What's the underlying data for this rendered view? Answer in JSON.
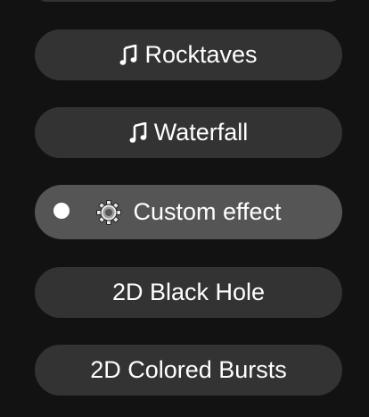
{
  "effects": {
    "items": [
      {
        "label": "Rocktaves",
        "icon": "music-note-icon"
      },
      {
        "label": "Waterfall",
        "icon": "music-note-icon"
      },
      {
        "label": "Custom effect",
        "icon": "gear-icon",
        "selected": true
      },
      {
        "label": "2D Black Hole"
      },
      {
        "label": "2D Colored Bursts"
      }
    ]
  },
  "colors": {
    "background": "#121212",
    "button": "#333333",
    "button_selected": "#555555",
    "text": "#ffffff"
  }
}
